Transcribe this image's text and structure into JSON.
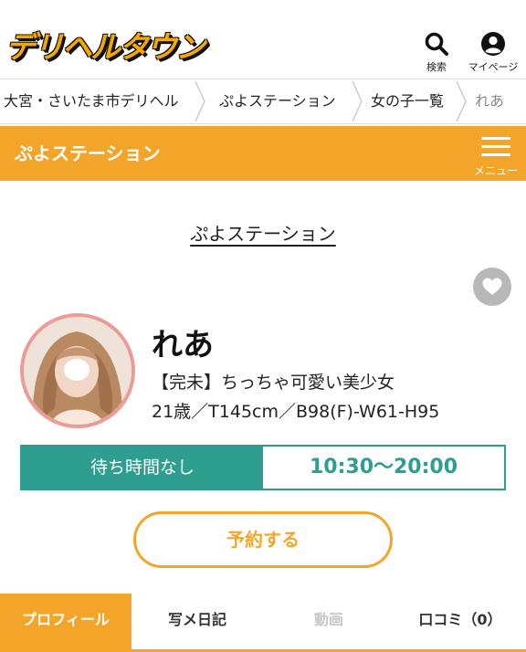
{
  "header": {
    "logo_text": "デリヘルタウン",
    "search_label": "検索",
    "mypage_label": "マイページ"
  },
  "breadcrumb": {
    "items": [
      "大宮・さいたま市デリヘル",
      "ぷよステーション",
      "女の子一覧",
      "れあ"
    ]
  },
  "shopbar": {
    "title": "ぷよステーション",
    "menu_label": "メニュー"
  },
  "shop_link": "ぷよステーション",
  "profile": {
    "name": "れあ",
    "catch_copy": "【完未】ちっちゃ可愛い美少女",
    "spec": "21歳／T145cm／B98(F)-W61-H95"
  },
  "status": {
    "wait_label": "待ち時間なし",
    "hours": "10:30〜20:00"
  },
  "reserve_label": "予約する",
  "tabs": [
    {
      "label": "プロフィール",
      "state": "active"
    },
    {
      "label": "写メ日記",
      "state": "normal"
    },
    {
      "label": "動画",
      "state": "disabled"
    },
    {
      "label": "口コミ（0）",
      "state": "normal"
    }
  ],
  "colors": {
    "accent": "#f3a52a",
    "teal": "#2d9e8f",
    "avatar_ring": "#ec9c96"
  }
}
